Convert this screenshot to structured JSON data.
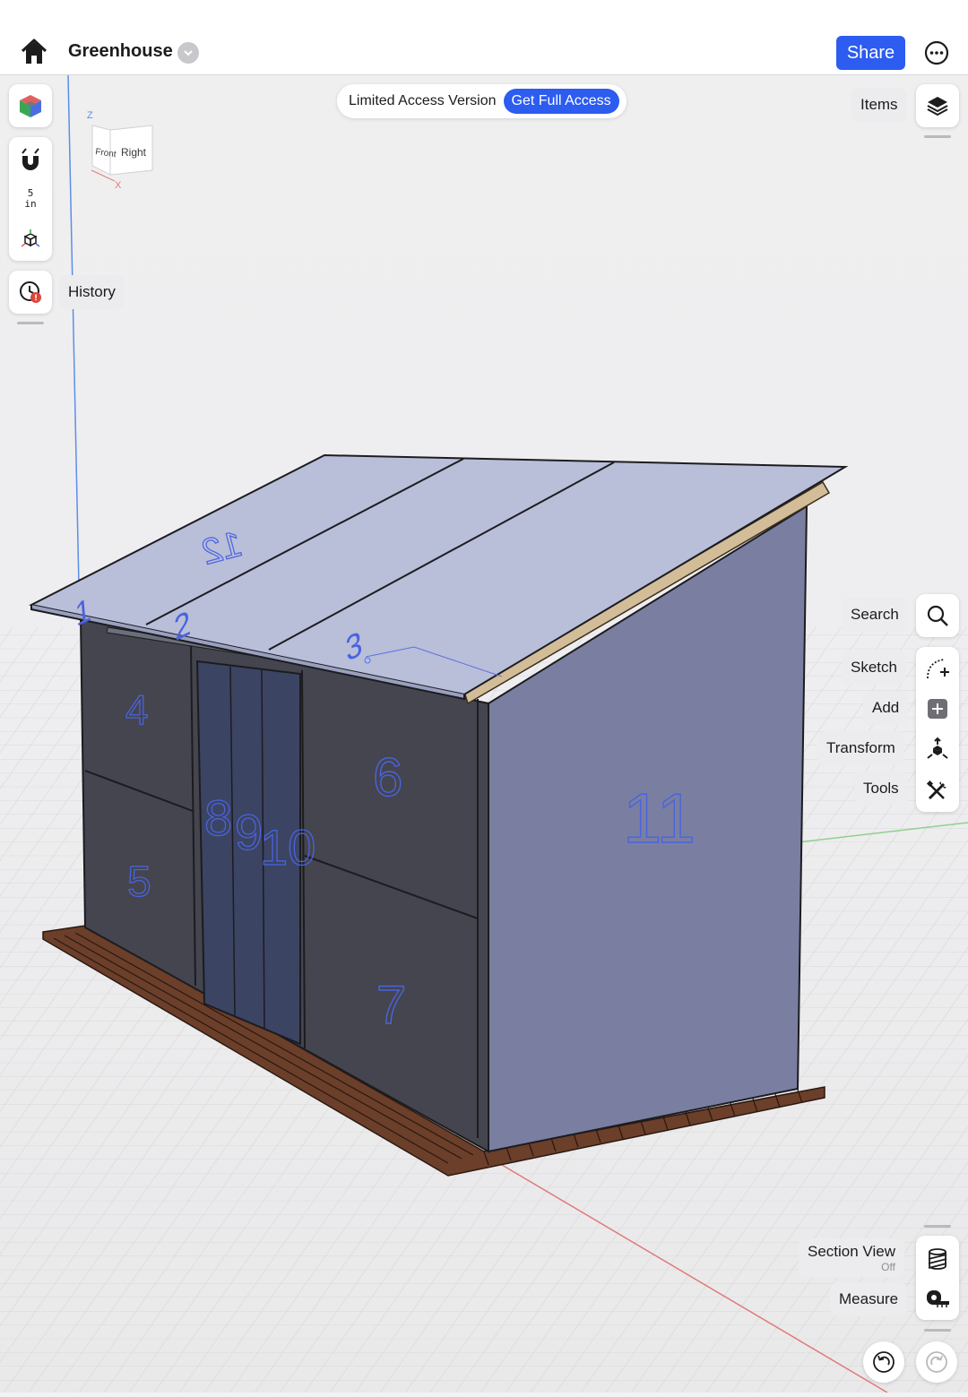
{
  "app": {
    "title": "Greenhouse",
    "share_label": "Share"
  },
  "banner": {
    "text": "Limited Access Version",
    "cta": "Get Full Access"
  },
  "left_toolbar": {
    "snap_value": "5",
    "snap_unit": "in",
    "history_label": "History"
  },
  "view_cube": {
    "front": "Front",
    "right": "Right",
    "z_axis": "Z",
    "x_axis": "X"
  },
  "right_toolbar": {
    "items_label": "Items",
    "search_label": "Search",
    "sketch_label": "Sketch",
    "add_label": "Add",
    "transform_label": "Transform",
    "tools_label": "Tools",
    "section_view_label": "Section View",
    "section_view_state": "Off",
    "measure_label": "Measure"
  },
  "model": {
    "panel_labels": [
      "1",
      "2",
      "3",
      "4",
      "5",
      "6",
      "7",
      "8",
      "9",
      "10",
      "11",
      "12"
    ]
  },
  "colors": {
    "accent": "#2c5cf0",
    "roof": "#b9bed9",
    "right_wall": "#7a7fa1",
    "front_wall": "#45464f",
    "deck": "#6b3f2a",
    "label_blue": "#4a63e0"
  }
}
